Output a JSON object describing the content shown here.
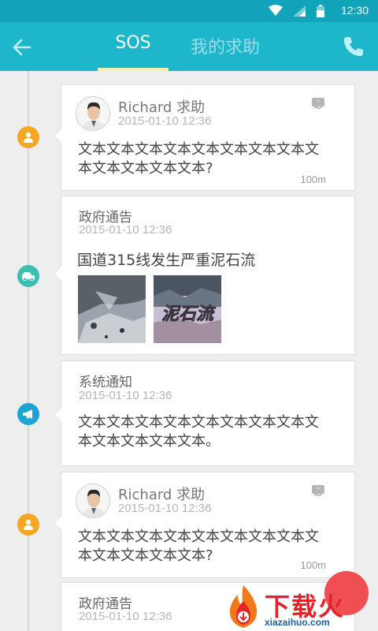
{
  "status_bar": {
    "time": "12:30",
    "icons": [
      "wifi-icon",
      "signal-icon",
      "battery-icon"
    ]
  },
  "app_bar": {
    "back_icon": "arrow-left-icon",
    "tabs": [
      {
        "label": "SOS",
        "active": true
      },
      {
        "label": "我的求助",
        "active": false
      }
    ],
    "call_icon": "phone-icon",
    "colors": {
      "background": "#1eb6ca",
      "underline": "#eef3b0"
    }
  },
  "feed": [
    {
      "type": "help_request",
      "node_icon": "person-icon",
      "node_color": "#f5a623",
      "author": "Richard 求助",
      "date": "2015-01-10 12:36",
      "comment_count": "6",
      "text": "文本文本文本文本文本文本文本文本文本文本文本文本文本?",
      "distance": "100m"
    },
    {
      "type": "gov_notice",
      "node_icon": "car-icon",
      "node_color": "#3cbfb0",
      "source": "政府通告",
      "date": "2015-01-10 12:36",
      "headline": "国道315线发生严重泥石流",
      "images": [
        "rockslide-photo",
        "mudslide-photo"
      ],
      "image_caption": "泥石流"
    },
    {
      "type": "system_notice",
      "node_icon": "megaphone-icon",
      "node_color": "#1aa5d6",
      "source": "系统通知",
      "date": "2015-01-10 12:36",
      "text": "文本文本文本文本文本文本文本文本文本文本文本文本文本。"
    },
    {
      "type": "help_request",
      "node_icon": "person-icon",
      "node_color": "#f5a623",
      "author": "Richard 求助",
      "date": "2015-01-10 12:36",
      "comment_count": "6",
      "text": "文本文本文本文本文本文本文本文本文本文本文本文本文本?",
      "distance": "100m"
    },
    {
      "type": "gov_notice",
      "source": "政府通告",
      "date": "2015-01-10 12:36"
    }
  ],
  "watermark": {
    "main": "下载火",
    "sub": "xiazaihuo.com",
    "color": "#e6222b"
  }
}
